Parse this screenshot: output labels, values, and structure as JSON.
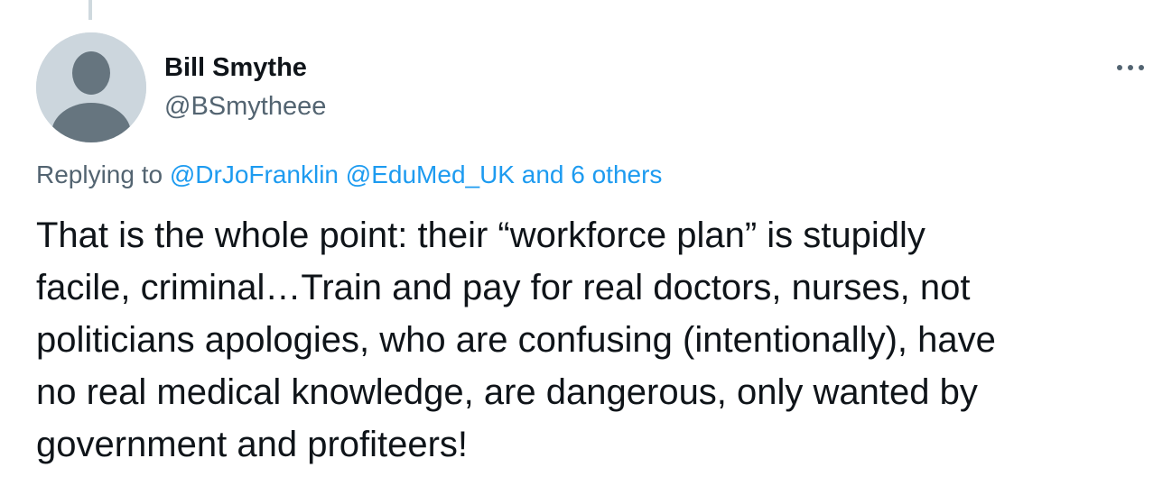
{
  "tweet": {
    "author": {
      "display_name": "Bill Smythe",
      "handle": "@BSmytheee",
      "avatar_icon": "default-profile-icon"
    },
    "more_icon": "more-horizontal-icon",
    "replying": {
      "prefix": "Replying to",
      "mentions": [
        "@DrJoFranklin",
        "@EduMed_UK"
      ],
      "others": "and 6 others"
    },
    "text": "That is the whole point: their “workforce plan” is stupidly\nfacile, criminal…Train and pay for real doctors, nurses, not\npoliticians apologies, who are confusing (intentionally), have\nno real medical knowledge, are dangerous, only wanted by\ngovernment and profiteers!"
  },
  "colors": {
    "text_primary": "#0f1419",
    "text_secondary": "#536471",
    "link": "#1d9bf0",
    "avatar_bg": "#ccd6dd",
    "avatar_figure": "#66757f",
    "thread_line": "#cfd9de"
  }
}
